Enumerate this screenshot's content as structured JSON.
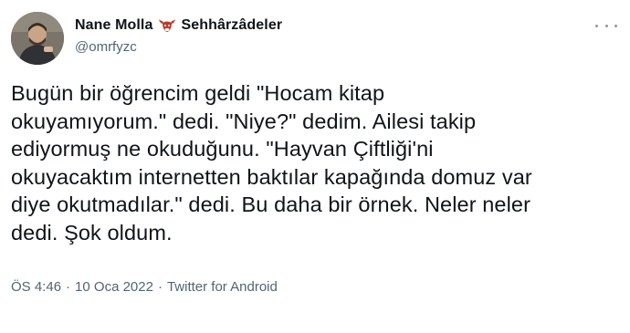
{
  "author": {
    "display_name": "Nane Molla",
    "handle": "@omrfyzc",
    "name_suffix": "Sehhârzâdeler",
    "emoji_icon": "bull-head-emoji"
  },
  "tweet": {
    "text": "Bugün bir öğrencim geldi \"Hocam kitap\nokuyamıyorum.\" dedi. \"Niye?\" dedim. Ailesi takip\nediyormuş ne okuduğunu. \"Hayvan Çiftliği'ni\nokuyacaktım internetten baktılar kapağında domuz var\ndiye okutmadılar.\" dedi. Bu daha bir örnek. Neler neler\ndedi. Şok oldum."
  },
  "meta": {
    "time": "ÖS 4:46",
    "separator": "·",
    "date": "10 Oca 2022",
    "source": "Twitter for Android"
  },
  "colors": {
    "text": "#0f1419",
    "secondary": "#536471",
    "emoji_red": "#c0392b"
  },
  "icons": {
    "more": "more-dots-icon"
  }
}
